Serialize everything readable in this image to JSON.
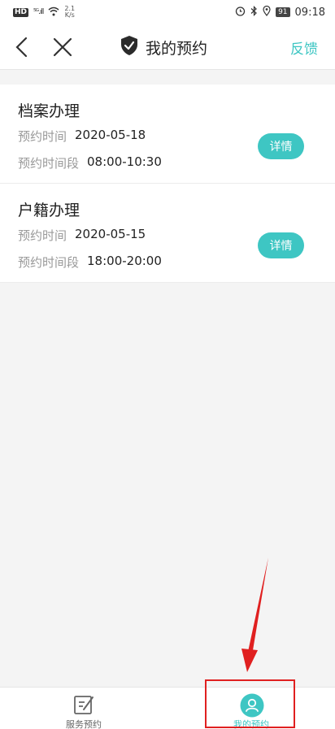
{
  "status_bar": {
    "hd": "HD",
    "signal": "⁵ᴳ.ıll",
    "speed_value": "2.1",
    "speed_unit": "K/s",
    "battery": "91",
    "time": "09:18"
  },
  "nav": {
    "title": "我的预约",
    "feedback": "反馈"
  },
  "appointments": [
    {
      "title": "档案办理",
      "date_label": "预约时间",
      "date": "2020-05-18",
      "time_label": "预约时间段",
      "time": "08:00-10:30",
      "button": "详情"
    },
    {
      "title": "户籍办理",
      "date_label": "预约时间",
      "date": "2020-05-15",
      "time_label": "预约时间段",
      "time": "18:00-20:00",
      "button": "详情"
    }
  ],
  "tabs": {
    "service": "服务预约",
    "mine": "我的预约"
  },
  "colors": {
    "accent": "#3ec6c3",
    "annotation": "#e02020"
  }
}
